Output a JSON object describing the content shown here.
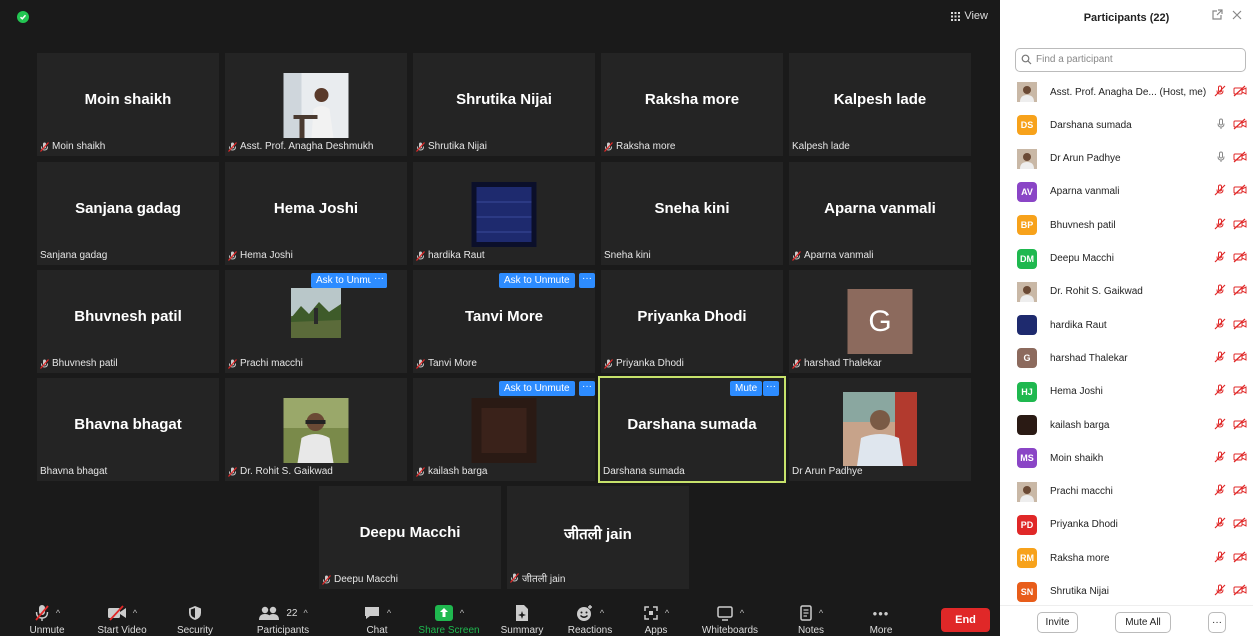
{
  "view_label": "View",
  "tiles": [
    {
      "name": "Moin shaikh",
      "label": "Moin shaikh",
      "muted": true,
      "display": "name"
    },
    {
      "name": "",
      "label": "Asst. Prof. Anagha Deshmukh",
      "muted": true,
      "display": "photo-speaker"
    },
    {
      "name": "Shrutika Nijai",
      "label": "Shrutika Nijai",
      "muted": true,
      "display": "name"
    },
    {
      "name": "Raksha more",
      "label": "Raksha more",
      "muted": true,
      "display": "name"
    },
    {
      "name": "Kalpesh lade",
      "label": "Kalpesh lade",
      "muted": false,
      "display": "name"
    },
    {
      "name": "Sanjana gadag",
      "label": "Sanjana gadag",
      "muted": false,
      "display": "name"
    },
    {
      "name": "Hema Joshi",
      "label": "Hema Joshi",
      "muted": true,
      "display": "name"
    },
    {
      "name": "",
      "label": "hardika Raut",
      "muted": true,
      "display": "photo-blue"
    },
    {
      "name": "Sneha kini",
      "label": "Sneha kini",
      "muted": false,
      "display": "name"
    },
    {
      "name": "Aparna vanmali",
      "label": "Aparna vanmali",
      "muted": true,
      "display": "name"
    },
    {
      "name": "Bhuvnesh patil",
      "label": "Bhuvnesh patil",
      "muted": true,
      "display": "name"
    },
    {
      "name": "",
      "label": "Prachi macchi",
      "muted": true,
      "display": "photo-field"
    },
    {
      "name": "Tanvi More",
      "label": "Tanvi More",
      "muted": true,
      "display": "name"
    },
    {
      "name": "Priyanka Dhodi",
      "label": "Priyanka Dhodi",
      "muted": true,
      "display": "name"
    },
    {
      "name": "G",
      "label": "harshad Thalekar",
      "muted": true,
      "display": "letter"
    },
    {
      "name": "Bhavna bhagat",
      "label": "Bhavna bhagat",
      "muted": false,
      "display": "name"
    },
    {
      "name": "",
      "label": "Dr. Rohit S. Gaikwad",
      "muted": true,
      "display": "photo-man"
    },
    {
      "name": "",
      "label": "kailash barga",
      "muted": true,
      "display": "photo-dark"
    },
    {
      "name": "Darshana sumada",
      "label": "Darshana sumada",
      "muted": false,
      "display": "name"
    },
    {
      "name": "",
      "label": "Dr Arun Padhye",
      "muted": false,
      "display": "photo-arun"
    },
    {
      "name": "Deepu Macchi",
      "label": "Deepu Macchi",
      "muted": true,
      "display": "name"
    },
    {
      "name": "जीतली jain",
      "label": "जीतली jain",
      "muted": true,
      "display": "name"
    }
  ],
  "ask_to_unmute": "Ask to Unmute",
  "mute_label": "Mute",
  "more_dots": "···",
  "toolbar": {
    "unmute": "Unmute",
    "start_video": "Start Video",
    "security": "Security",
    "participants": "Participants",
    "participants_count": "22",
    "chat": "Chat",
    "share_screen": "Share Screen",
    "summary": "Summary",
    "reactions": "Reactions",
    "apps": "Apps",
    "whiteboards": "Whiteboards",
    "notes": "Notes",
    "more": "More",
    "end": "End"
  },
  "panel": {
    "title": "Participants (22)",
    "search_placeholder": "Find a participant",
    "participants": [
      {
        "initials": "",
        "name": "Asst. Prof. Anagha De...",
        "suffix": "(Host, me)",
        "color": "photo",
        "mic": "muted"
      },
      {
        "initials": "DS",
        "name": "Darshana sumada",
        "suffix": "",
        "color": "#f7a21b",
        "mic": "on"
      },
      {
        "initials": "",
        "name": "Dr Arun Padhye",
        "suffix": "",
        "color": "photo",
        "mic": "on"
      },
      {
        "initials": "AV",
        "name": "Aparna vanmali",
        "suffix": "",
        "color": "#8a45c6",
        "mic": "muted"
      },
      {
        "initials": "BP",
        "name": "Bhuvnesh patil",
        "suffix": "",
        "color": "#f7a21b",
        "mic": "muted"
      },
      {
        "initials": "DM",
        "name": "Deepu Macchi",
        "suffix": "",
        "color": "#1fb84f",
        "mic": "muted"
      },
      {
        "initials": "",
        "name": "Dr. Rohit S. Gaikwad",
        "suffix": "",
        "color": "photo",
        "mic": "muted"
      },
      {
        "initials": "",
        "name": "hardika Raut",
        "suffix": "",
        "color": "#1e2a6e",
        "mic": "muted"
      },
      {
        "initials": "G",
        "name": "harshad Thalekar",
        "suffix": "",
        "color": "#8c6a5d",
        "mic": "muted"
      },
      {
        "initials": "HJ",
        "name": "Hema Joshi",
        "suffix": "",
        "color": "#1fb84f",
        "mic": "muted"
      },
      {
        "initials": "",
        "name": "kailash barga",
        "suffix": "",
        "color": "#2a1a14",
        "mic": "muted"
      },
      {
        "initials": "MS",
        "name": "Moin shaikh",
        "suffix": "",
        "color": "#8a45c6",
        "mic": "muted"
      },
      {
        "initials": "",
        "name": "Prachi macchi",
        "suffix": "",
        "color": "photo",
        "mic": "muted"
      },
      {
        "initials": "PD",
        "name": "Priyanka Dhodi",
        "suffix": "",
        "color": "#e02828",
        "mic": "muted"
      },
      {
        "initials": "RM",
        "name": "Raksha more",
        "suffix": "",
        "color": "#f7a21b",
        "mic": "muted"
      },
      {
        "initials": "SN",
        "name": "Shrutika Nijai",
        "suffix": "",
        "color": "#e85d1a",
        "mic": "muted"
      }
    ],
    "invite": "Invite",
    "mute_all": "Mute All",
    "more": "···"
  }
}
